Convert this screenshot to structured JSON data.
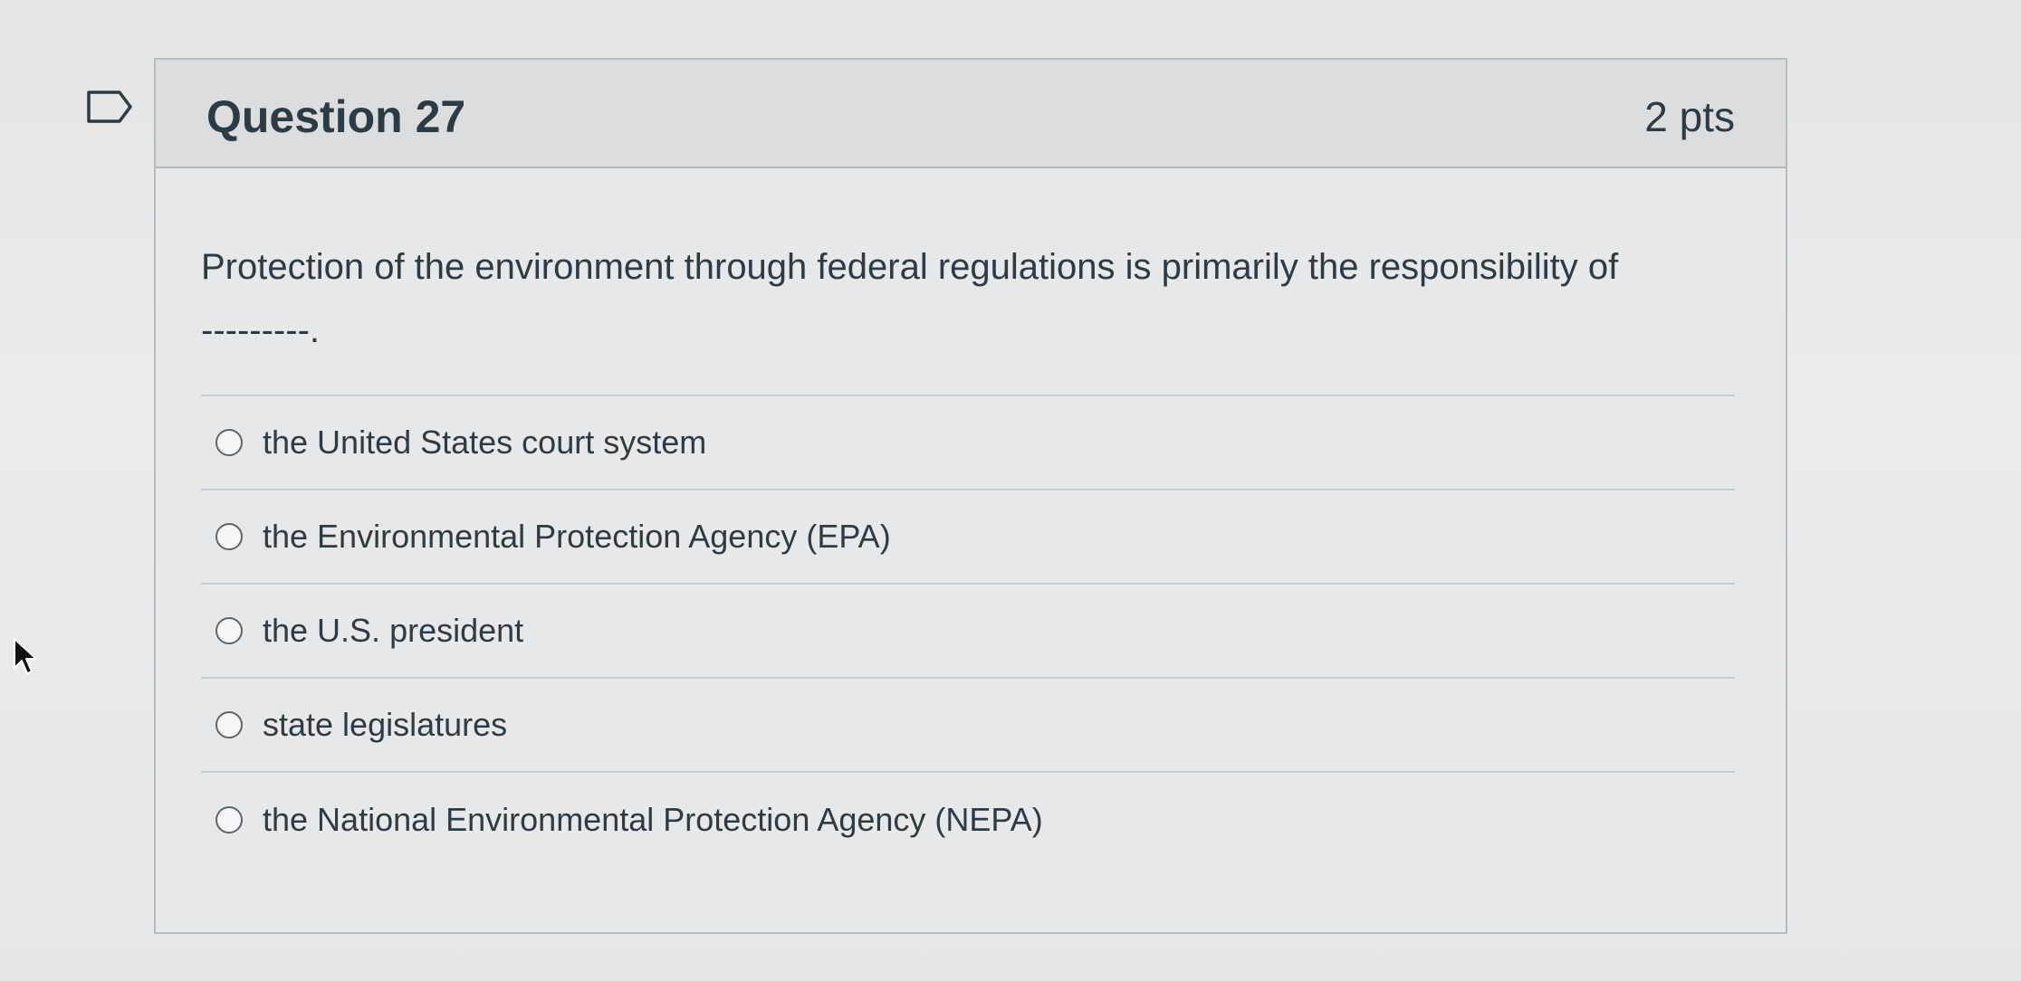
{
  "question": {
    "title": "Question 27",
    "points": "2 pts",
    "text_line1": "Protection of the environment through federal regulations is primarily the responsibility of",
    "text_line2": "---------."
  },
  "answers": [
    {
      "label": "the United States court system"
    },
    {
      "label": "the Environmental Protection Agency (EPA)"
    },
    {
      "label": "the U.S. president"
    },
    {
      "label": "state legislatures"
    },
    {
      "label": "the National Environmental Protection Agency (NEPA)"
    }
  ],
  "icons": {
    "flag": "flag-question-icon",
    "cursor": "mouse-pointer-icon"
  },
  "colors": {
    "text": "#2d3b45",
    "header_bg": "#dcdddf",
    "border": "#b8bcc0"
  }
}
